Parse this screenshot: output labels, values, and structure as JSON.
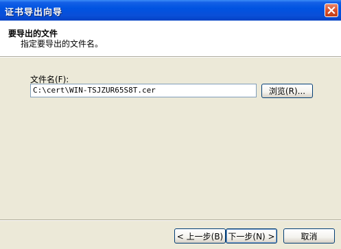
{
  "window": {
    "title": "证书导出向导"
  },
  "header": {
    "title": "要导出的文件",
    "subtitle": "指定要导出的文件名。"
  },
  "form": {
    "file_label": "文件名(F):",
    "file_value": "C:\\cert\\WIN-TSJZUR65S8T.cer",
    "browse_label": "浏览(R)..."
  },
  "footer": {
    "back_label": "< 上一步(B)",
    "next_label": "下一步(N) >",
    "cancel_label": "取消"
  },
  "icons": {
    "close": "close-icon"
  },
  "colors": {
    "titlebar": "#0053e1",
    "close_button": "#d9502c",
    "dialog_background": "#ece9d8",
    "header_background": "#ffffff"
  }
}
